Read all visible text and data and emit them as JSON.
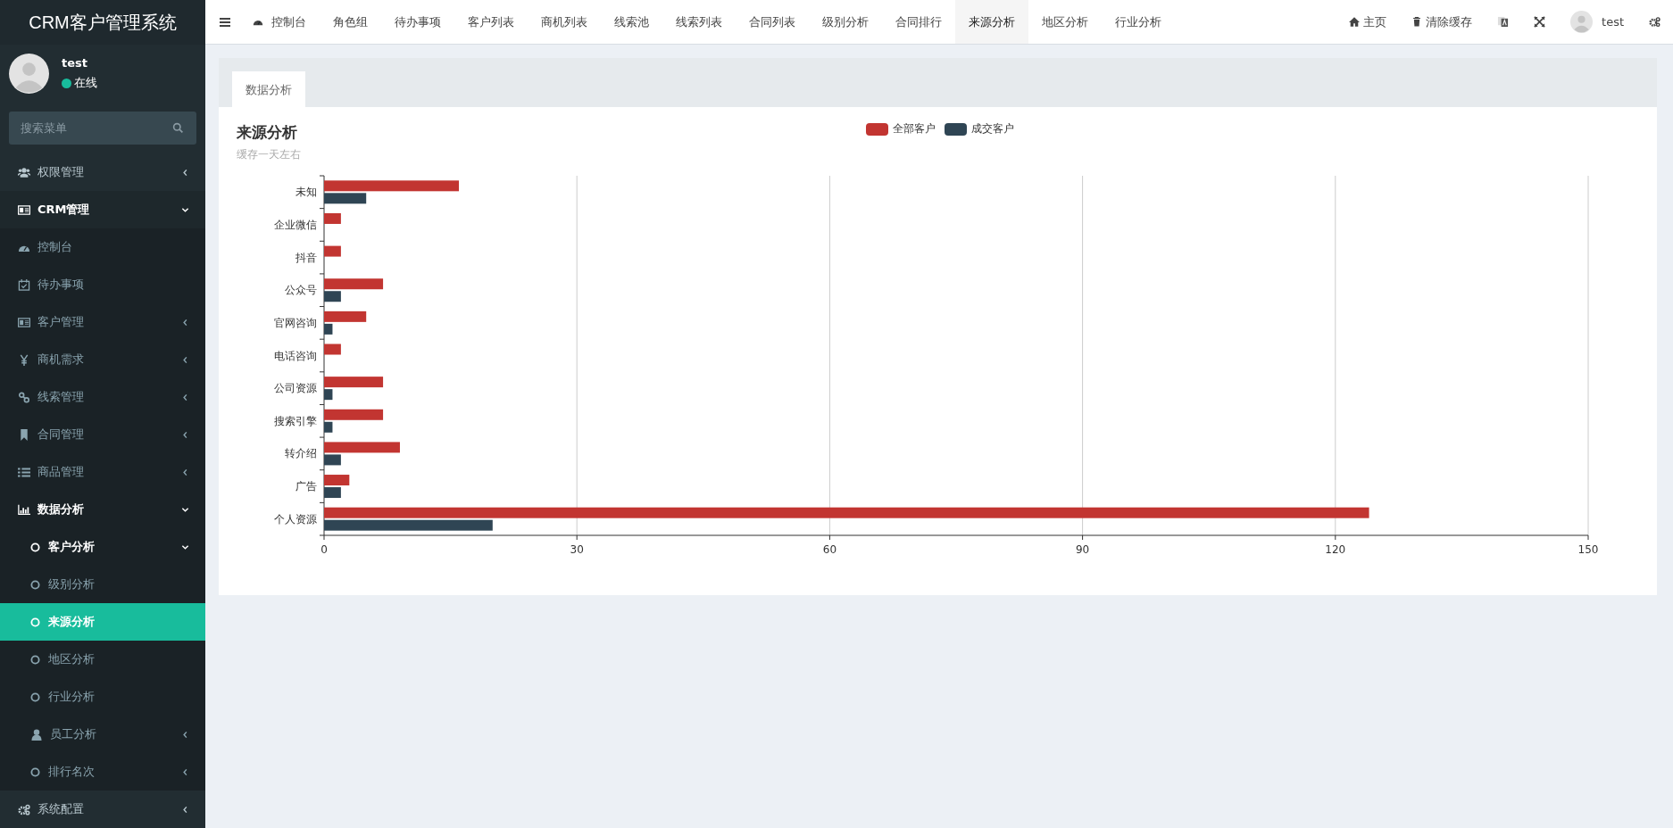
{
  "sidebar": {
    "logo": "CRM客户管理系统",
    "user": {
      "name": "test",
      "status": "在线"
    },
    "search": {
      "placeholder": "搜索菜单"
    },
    "menu": [
      {
        "label": "权限管理",
        "expanded": false,
        "selected": false
      },
      {
        "label": "CRM管理",
        "expanded": true,
        "selected": false,
        "children": [
          {
            "label": "控制台",
            "selected": false
          },
          {
            "label": "待办事项",
            "selected": false
          },
          {
            "label": "客户管理",
            "expanded": false,
            "selected": false
          },
          {
            "label": "商机需求",
            "expanded": false,
            "selected": false
          },
          {
            "label": "线索管理",
            "expanded": false,
            "selected": false
          },
          {
            "label": "合同管理",
            "expanded": false,
            "selected": false
          },
          {
            "label": "商品管理",
            "expanded": false,
            "selected": false
          },
          {
            "label": "数据分析",
            "expanded": true,
            "selected": false,
            "children": [
              {
                "label": "客户分析",
                "expanded": true,
                "selected": false,
                "children": [
                  {
                    "label": "级别分析",
                    "selected": false
                  },
                  {
                    "label": "来源分析",
                    "selected": true
                  },
                  {
                    "label": "地区分析",
                    "selected": false
                  },
                  {
                    "label": "行业分析",
                    "selected": false
                  }
                ]
              },
              {
                "label": "员工分析",
                "expanded": false,
                "selected": false
              },
              {
                "label": "排行名次",
                "expanded": false,
                "selected": false
              }
            ]
          }
        ]
      },
      {
        "label": "系统配置",
        "expanded": false,
        "selected": false
      }
    ]
  },
  "topbar": {
    "tabs": [
      {
        "label": "控制台",
        "selected": false
      },
      {
        "label": "角色组",
        "selected": false
      },
      {
        "label": "待办事项",
        "selected": false
      },
      {
        "label": "客户列表",
        "selected": false
      },
      {
        "label": "商机列表",
        "selected": false
      },
      {
        "label": "线索池",
        "selected": false
      },
      {
        "label": "线索列表",
        "selected": false
      },
      {
        "label": "合同列表",
        "selected": false
      },
      {
        "label": "级别分析",
        "selected": false
      },
      {
        "label": "合同排行",
        "selected": false
      },
      {
        "label": "来源分析",
        "selected": true
      },
      {
        "label": "地区分析",
        "selected": false
      },
      {
        "label": "行业分析",
        "selected": false
      }
    ],
    "actions": [
      {
        "label": "主页"
      },
      {
        "label": "清除缓存"
      }
    ],
    "user": "test"
  },
  "content": {
    "tabs": [
      {
        "label": "数据分析",
        "selected": true
      }
    ],
    "card": {
      "title": "来源分析",
      "subtitle": "缓存一天左右",
      "chart_data": {
        "type": "bar",
        "orientation": "horizontal",
        "categories": [
          "未知",
          "企业微信",
          "抖音",
          "公众号",
          "官网咨询",
          "电话咨询",
          "公司资源",
          "搜索引擎",
          "转介绍",
          "广告",
          "个人资源"
        ],
        "series": [
          {
            "name": "全部客户",
            "color": "#c23531",
            "values": [
              16,
              2,
              2,
              7,
              5,
              2,
              7,
              7,
              9,
              3,
              124
            ]
          },
          {
            "name": "成交客户",
            "color": "#2f4554",
            "values": [
              5,
              0,
              0,
              2,
              1,
              0,
              1,
              1,
              2,
              2,
              20
            ]
          }
        ],
        "grid": true,
        "xlim": [
          0,
          150
        ],
        "xticks": [
          0,
          30,
          60,
          90,
          120,
          150
        ]
      }
    }
  }
}
